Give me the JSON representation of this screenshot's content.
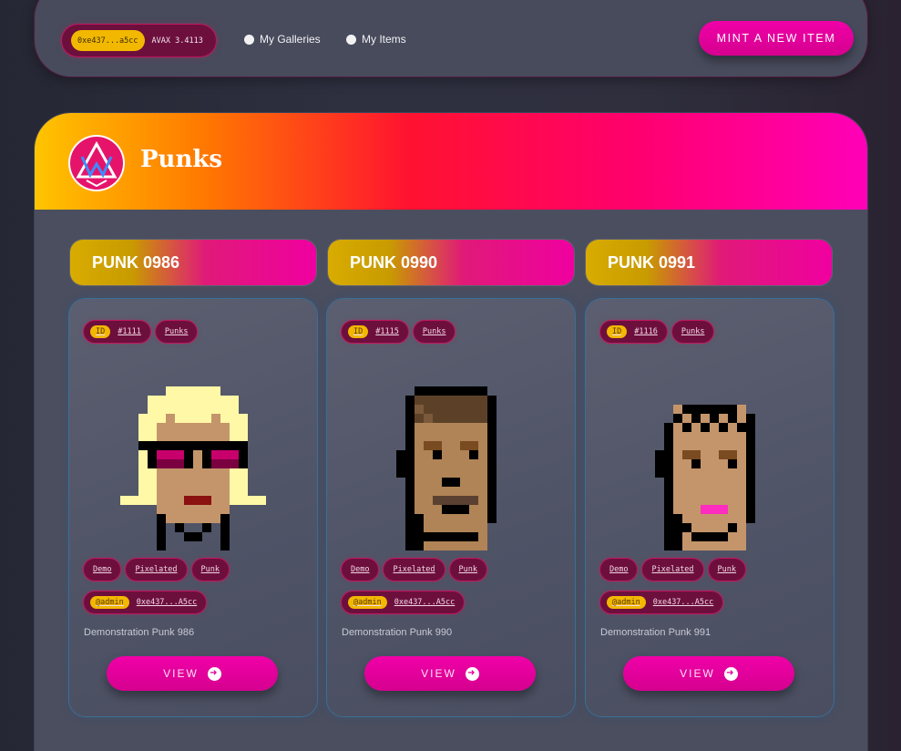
{
  "topbar": {
    "wallet_address": "0xe437...a5cc",
    "balance": "AVAX 3.4113",
    "radio_galleries": "My Galleries",
    "radio_items": "My Items",
    "mint_label": "MINT A NEW ITEM"
  },
  "gallery": {
    "title": "Punks",
    "logo_icon": "triangle-v-logo"
  },
  "colors": {
    "accent": "#ff00b8",
    "chip_bg": "#6d0f3d",
    "yellow": "#f2b800"
  },
  "cards": [
    {
      "title": "PUNK 0986",
      "id_label": "ID",
      "id": "#1111",
      "collection": "Punks",
      "tags": [
        "Demo",
        "Pixelated",
        "Punk"
      ],
      "owner_label": "@admin",
      "owner": "0xe437...A5cc",
      "description": "Demonstration Punk 986",
      "view_label": "VIEW"
    },
    {
      "title": "PUNK 0990",
      "id_label": "ID",
      "id": "#1115",
      "collection": "Punks",
      "tags": [
        "Demo",
        "Pixelated",
        "Punk"
      ],
      "owner_label": "@admin",
      "owner": "0xe437...A5cc",
      "description": "Demonstration Punk 990",
      "view_label": "VIEW"
    },
    {
      "title": "PUNK 0991",
      "id_label": "ID",
      "id": "#1116",
      "collection": "Punks",
      "tags": [
        "Demo",
        "Pixelated",
        "Punk"
      ],
      "owner_label": "@admin",
      "owner": "0xe437...A5cc",
      "description": "Demonstration Punk 991",
      "view_label": "VIEW"
    }
  ]
}
